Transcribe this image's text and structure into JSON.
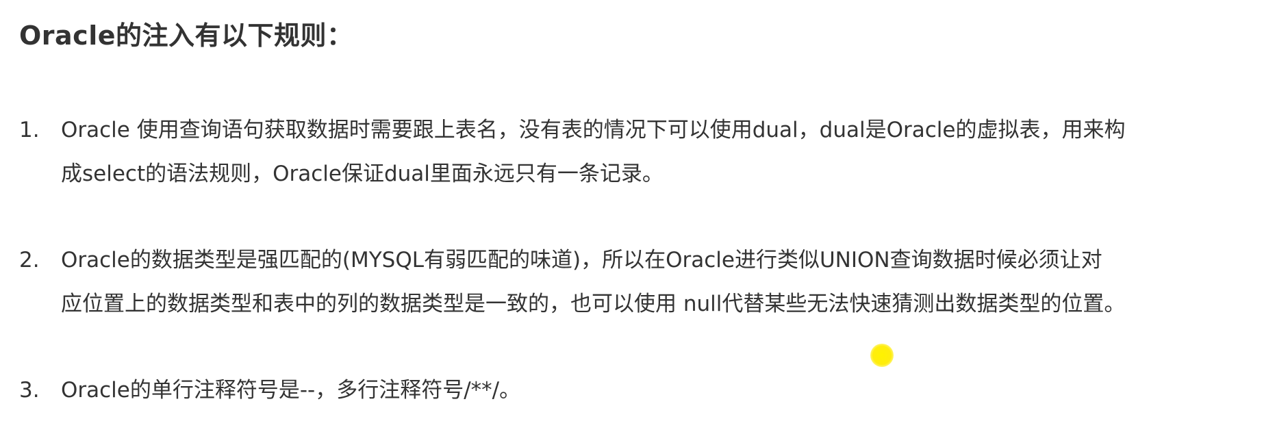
{
  "heading": "Oracle的注入有以下规则：",
  "rules": [
    {
      "number": "1.",
      "lines": [
        "Oracle 使用查询语句获取数据时需要跟上表名，没有表的情况下可以使用dual，dual是Oracle的虚拟表，用来构",
        "成select的语法规则，Oracle保证dual里面永远只有一条记录。"
      ]
    },
    {
      "number": "2.",
      "lines": [
        "Oracle的数据类型是强匹配的(MYSQL有弱匹配的味道)，所以在Oracle进行类似UNION查询数据时候必须让对",
        "应位置上的数据类型和表中的列的数据类型是一致的，也可以使用 null代替某些无法快速猜测出数据类型的位置。"
      ]
    },
    {
      "number": "3.",
      "lines": [
        "Oracle的单行注释符号是--，多行注释符号/**/。"
      ]
    }
  ],
  "cursor_highlight_color": "#fff200"
}
